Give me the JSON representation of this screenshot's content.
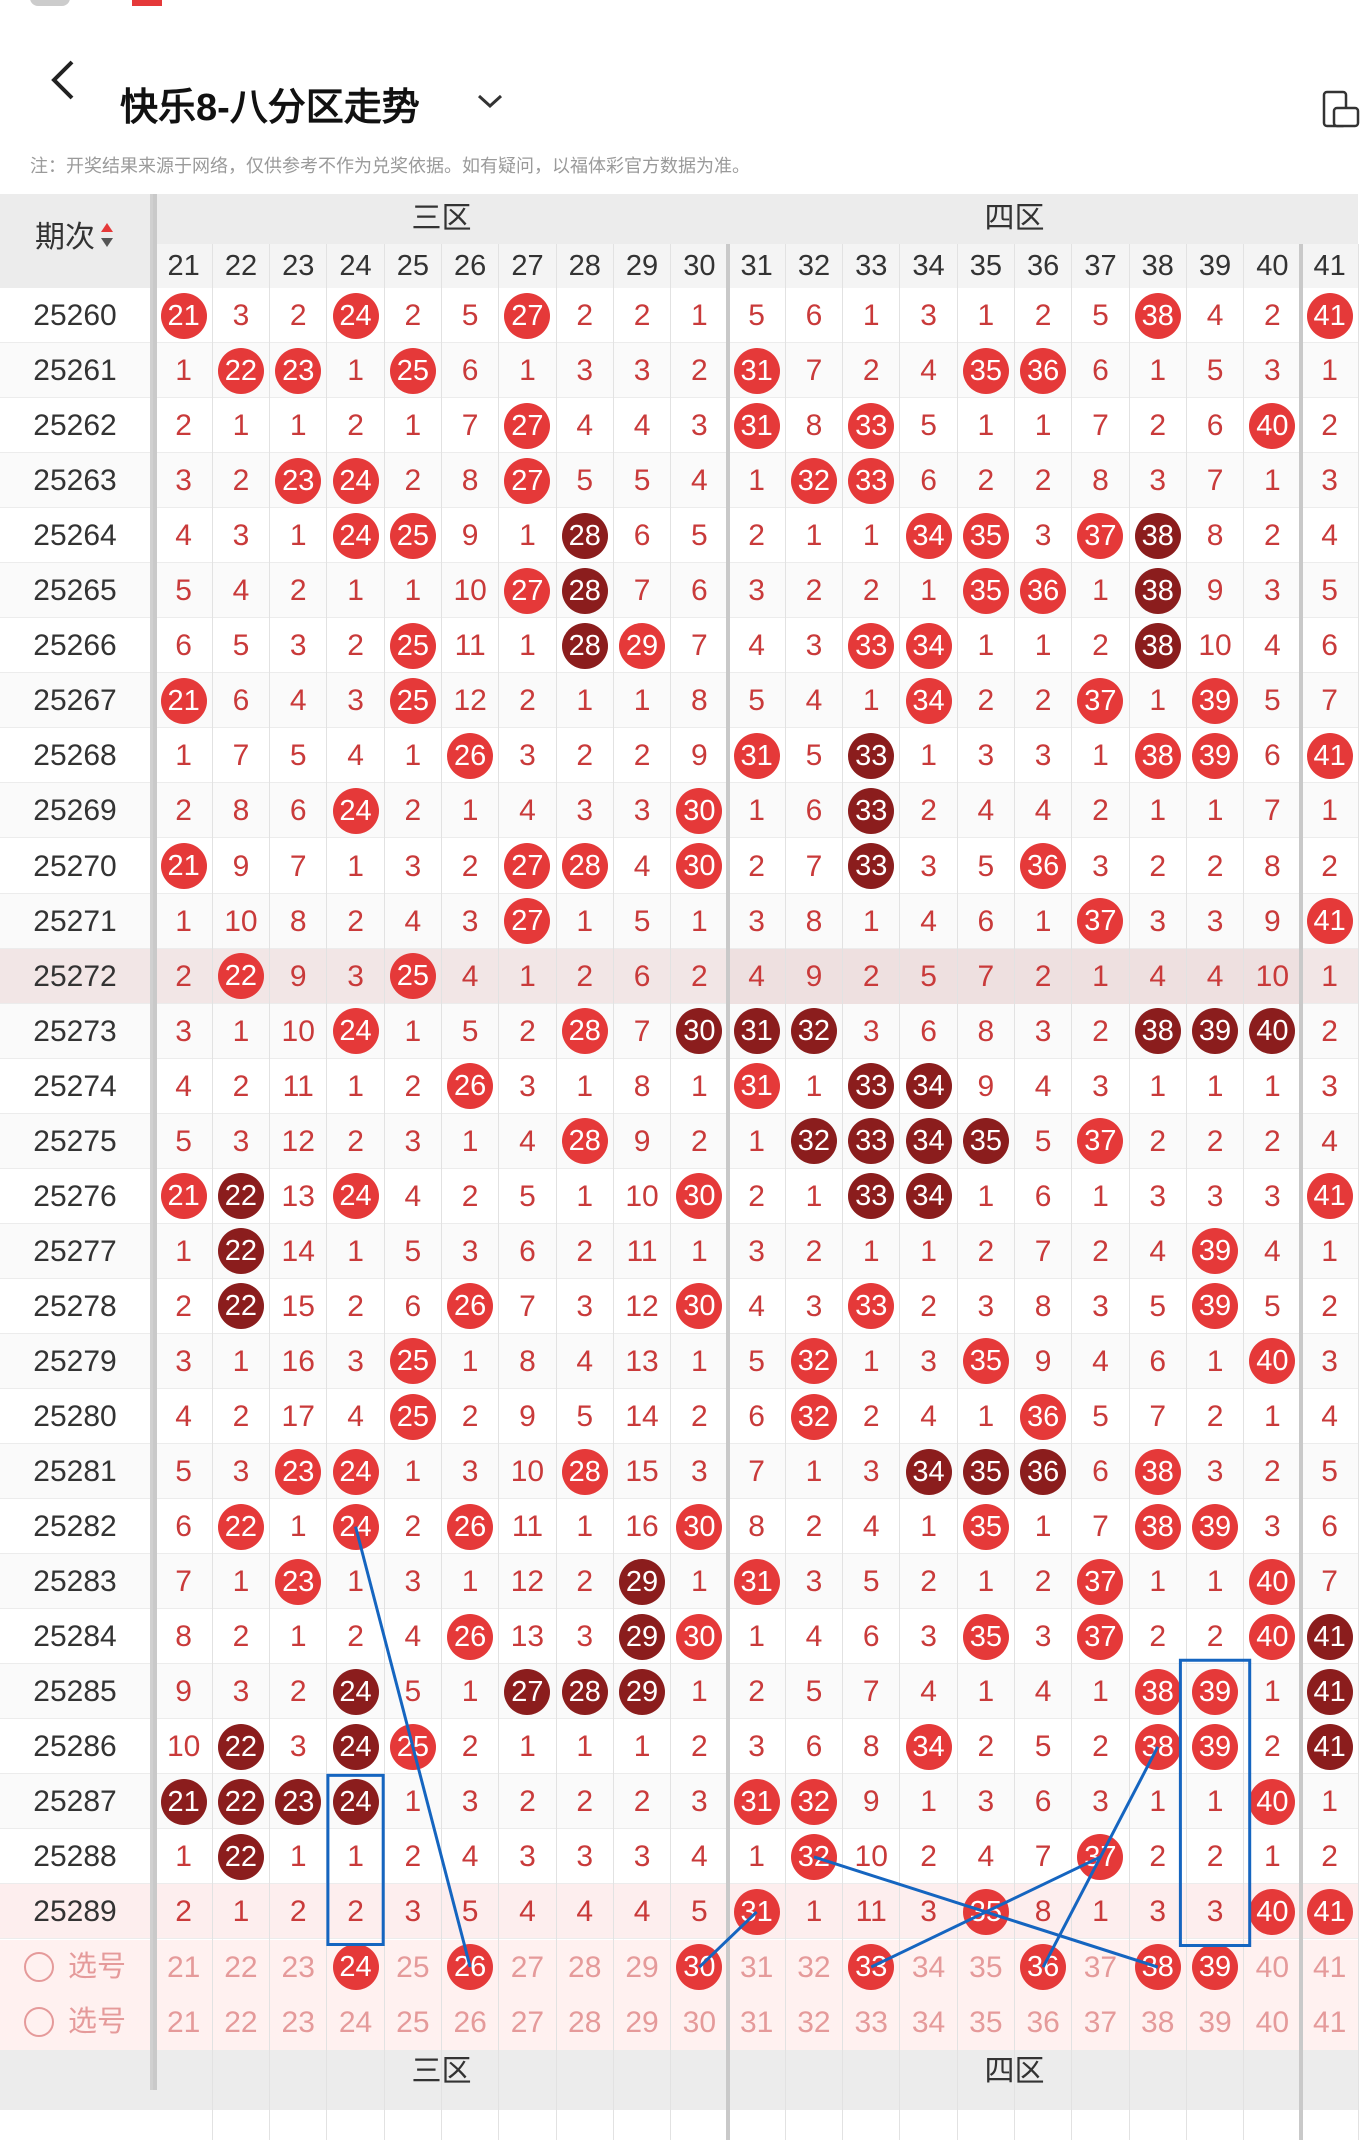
{
  "header": {
    "title": "快乐8-八分区走势",
    "back_icon": "back-arrow-icon",
    "dropdown_icon": "chevron-down-icon",
    "device_icon": "device-switch-icon"
  },
  "note": "注：开奖结果来源于网络，仅供参考不作为兑奖依据。如有疑问，以福体彩官方数据为准。",
  "table": {
    "period_header": "期次",
    "zones": [
      "三区",
      "四区"
    ],
    "columns": [
      "21",
      "22",
      "23",
      "24",
      "25",
      "26",
      "27",
      "28",
      "29",
      "30",
      "31",
      "32",
      "33",
      "34",
      "35",
      "36",
      "37",
      "38",
      "39",
      "40",
      "41"
    ],
    "rows": [
      {
        "p": "25260",
        "v": [
          "21",
          "3",
          "2",
          "24",
          "2",
          "5",
          "27",
          "2",
          "2",
          "1",
          "5",
          "6",
          "1",
          "3",
          "1",
          "2",
          "5",
          "38",
          "4",
          "2",
          "41"
        ]
      },
      {
        "p": "25261",
        "v": [
          "1",
          "22",
          "23",
          "1",
          "25",
          "6",
          "1",
          "3",
          "3",
          "2",
          "31",
          "7",
          "2",
          "4",
          "35",
          "36",
          "6",
          "1",
          "5",
          "3",
          "1"
        ]
      },
      {
        "p": "25262",
        "v": [
          "2",
          "1",
          "1",
          "2",
          "1",
          "7",
          "27",
          "4",
          "4",
          "3",
          "31",
          "8",
          "33",
          "5",
          "1",
          "1",
          "7",
          "2",
          "6",
          "40",
          "2"
        ]
      },
      {
        "p": "25263",
        "v": [
          "3",
          "2",
          "23",
          "24",
          "2",
          "8",
          "27",
          "5",
          "5",
          "4",
          "1",
          "32",
          "33",
          "6",
          "2",
          "2",
          "8",
          "3",
          "7",
          "1",
          "3"
        ]
      },
      {
        "p": "25264",
        "v": [
          "4",
          "3",
          "1",
          "24",
          "25",
          "9",
          "1",
          "28",
          "6",
          "5",
          "2",
          "1",
          "1",
          "34",
          "35",
          "3",
          "37",
          "38",
          "8",
          "2",
          "4"
        ]
      },
      {
        "p": "25265",
        "v": [
          "5",
          "4",
          "2",
          "1",
          "1",
          "10",
          "27",
          "28",
          "7",
          "6",
          "3",
          "2",
          "2",
          "1",
          "35",
          "36",
          "1",
          "38",
          "9",
          "3",
          "5"
        ]
      },
      {
        "p": "25266",
        "v": [
          "6",
          "5",
          "3",
          "2",
          "25",
          "11",
          "1",
          "28",
          "29",
          "7",
          "4",
          "3",
          "33",
          "34",
          "1",
          "1",
          "2",
          "38",
          "10",
          "4",
          "6"
        ]
      },
      {
        "p": "25267",
        "v": [
          "21",
          "6",
          "4",
          "3",
          "25",
          "12",
          "2",
          "1",
          "1",
          "8",
          "5",
          "4",
          "1",
          "34",
          "2",
          "2",
          "37",
          "1",
          "39",
          "5",
          "7"
        ]
      },
      {
        "p": "25268",
        "v": [
          "1",
          "7",
          "5",
          "4",
          "1",
          "26",
          "3",
          "2",
          "2",
          "9",
          "31",
          "5",
          "33",
          "1",
          "3",
          "3",
          "1",
          "38",
          "39",
          "6",
          "41"
        ]
      },
      {
        "p": "25269",
        "v": [
          "2",
          "8",
          "6",
          "24",
          "2",
          "1",
          "4",
          "3",
          "3",
          "30",
          "1",
          "6",
          "33",
          "2",
          "4",
          "4",
          "2",
          "1",
          "1",
          "7",
          "1"
        ]
      },
      {
        "p": "25270",
        "v": [
          "21",
          "9",
          "7",
          "1",
          "3",
          "2",
          "27",
          "28",
          "4",
          "30",
          "2",
          "7",
          "33",
          "3",
          "5",
          "36",
          "3",
          "2",
          "2",
          "8",
          "2"
        ]
      },
      {
        "p": "25271",
        "v": [
          "1",
          "10",
          "8",
          "2",
          "4",
          "3",
          "27",
          "1",
          "5",
          "1",
          "3",
          "8",
          "1",
          "4",
          "6",
          "1",
          "37",
          "3",
          "3",
          "9",
          "41"
        ]
      },
      {
        "p": "25272",
        "v": [
          "2",
          "22",
          "9",
          "3",
          "25",
          "4",
          "1",
          "2",
          "6",
          "2",
          "4",
          "9",
          "2",
          "5",
          "7",
          "2",
          "1",
          "4",
          "4",
          "10",
          "1"
        ]
      },
      {
        "p": "25273",
        "v": [
          "3",
          "1",
          "10",
          "24",
          "1",
          "5",
          "2",
          "28",
          "7",
          "30",
          "31",
          "32",
          "3",
          "6",
          "8",
          "3",
          "2",
          "38",
          "39",
          "40",
          "2"
        ]
      },
      {
        "p": "25274",
        "v": [
          "4",
          "2",
          "11",
          "1",
          "2",
          "26",
          "3",
          "1",
          "8",
          "1",
          "31",
          "1",
          "33",
          "34",
          "9",
          "4",
          "3",
          "1",
          "1",
          "1",
          "3"
        ]
      },
      {
        "p": "25275",
        "v": [
          "5",
          "3",
          "12",
          "2",
          "3",
          "1",
          "4",
          "28",
          "9",
          "2",
          "1",
          "32",
          "33",
          "34",
          "35",
          "5",
          "37",
          "2",
          "2",
          "2",
          "4"
        ]
      },
      {
        "p": "25276",
        "v": [
          "21",
          "22",
          "13",
          "24",
          "4",
          "2",
          "5",
          "1",
          "10",
          "30",
          "2",
          "1",
          "33",
          "34",
          "1",
          "6",
          "1",
          "3",
          "3",
          "3",
          "41"
        ]
      },
      {
        "p": "25277",
        "v": [
          "1",
          "22",
          "14",
          "1",
          "5",
          "3",
          "6",
          "2",
          "11",
          "1",
          "3",
          "2",
          "1",
          "1",
          "2",
          "7",
          "2",
          "4",
          "39",
          "4",
          "1"
        ]
      },
      {
        "p": "25278",
        "v": [
          "2",
          "22",
          "15",
          "2",
          "6",
          "26",
          "7",
          "3",
          "12",
          "30",
          "4",
          "3",
          "33",
          "2",
          "3",
          "8",
          "3",
          "5",
          "39",
          "5",
          "2"
        ]
      },
      {
        "p": "25279",
        "v": [
          "3",
          "1",
          "16",
          "3",
          "25",
          "1",
          "8",
          "4",
          "13",
          "1",
          "5",
          "32",
          "1",
          "3",
          "35",
          "9",
          "4",
          "6",
          "1",
          "40",
          "3"
        ]
      },
      {
        "p": "25280",
        "v": [
          "4",
          "2",
          "17",
          "4",
          "25",
          "2",
          "9",
          "5",
          "14",
          "2",
          "6",
          "32",
          "2",
          "4",
          "1",
          "36",
          "5",
          "7",
          "2",
          "1",
          "4"
        ]
      },
      {
        "p": "25281",
        "v": [
          "5",
          "3",
          "23",
          "24",
          "1",
          "3",
          "10",
          "28",
          "15",
          "3",
          "7",
          "1",
          "3",
          "34",
          "35",
          "36",
          "6",
          "38",
          "3",
          "2",
          "5"
        ]
      },
      {
        "p": "25282",
        "v": [
          "6",
          "22",
          "1",
          "24",
          "2",
          "26",
          "11",
          "1",
          "16",
          "30",
          "8",
          "2",
          "4",
          "1",
          "35",
          "1",
          "7",
          "38",
          "39",
          "3",
          "6"
        ]
      },
      {
        "p": "25283",
        "v": [
          "7",
          "1",
          "23",
          "1",
          "3",
          "1",
          "12",
          "2",
          "29",
          "1",
          "31",
          "3",
          "5",
          "2",
          "1",
          "2",
          "37",
          "1",
          "1",
          "40",
          "7"
        ]
      },
      {
        "p": "25284",
        "v": [
          "8",
          "2",
          "1",
          "2",
          "4",
          "26",
          "13",
          "3",
          "29",
          "30",
          "1",
          "4",
          "6",
          "3",
          "35",
          "3",
          "37",
          "2",
          "2",
          "40",
          "41"
        ]
      },
      {
        "p": "25285",
        "v": [
          "9",
          "3",
          "2",
          "24",
          "5",
          "1",
          "27",
          "28",
          "29",
          "1",
          "2",
          "5",
          "7",
          "4",
          "1",
          "4",
          "1",
          "38",
          "39",
          "1",
          "41"
        ]
      },
      {
        "p": "25286",
        "v": [
          "10",
          "22",
          "3",
          "24",
          "25",
          "2",
          "1",
          "1",
          "1",
          "2",
          "3",
          "6",
          "8",
          "34",
          "2",
          "5",
          "2",
          "38",
          "39",
          "2",
          "41"
        ]
      },
      {
        "p": "25287",
        "v": [
          "21",
          "22",
          "23",
          "24",
          "1",
          "3",
          "2",
          "2",
          "2",
          "3",
          "31",
          "32",
          "9",
          "1",
          "3",
          "6",
          "3",
          "1",
          "1",
          "40",
          "1"
        ]
      },
      {
        "p": "25288",
        "v": [
          "1",
          "22",
          "1",
          "1",
          "2",
          "4",
          "3",
          "3",
          "3",
          "4",
          "1",
          "32",
          "10",
          "2",
          "4",
          "7",
          "37",
          "2",
          "2",
          "1",
          "2"
        ]
      },
      {
        "p": "25289",
        "v": [
          "2",
          "1",
          "2",
          "2",
          "3",
          "5",
          "4",
          "4",
          "4",
          "5",
          "31",
          "1",
          "11",
          "3",
          "35",
          "8",
          "1",
          "3",
          "3",
          "40",
          "41"
        ]
      }
    ],
    "select_label": "选号",
    "select_rows": [
      [
        "21",
        "22",
        "23",
        "24",
        "25",
        "26",
        "27",
        "28",
        "29",
        "30",
        "31",
        "32",
        "33",
        "34",
        "35",
        "36",
        "37",
        "38",
        "39",
        "40",
        "41"
      ],
      [
        "21",
        "22",
        "23",
        "24",
        "25",
        "26",
        "27",
        "28",
        "29",
        "30",
        "31",
        "32",
        "33",
        "34",
        "35",
        "36",
        "37",
        "38",
        "39",
        "40",
        "41"
      ]
    ],
    "selected_picks": [
      "24",
      "26",
      "30",
      "33",
      "36",
      "38",
      "39"
    ]
  },
  "colors": {
    "ball_red": "#e53939",
    "ball_dark": "#8b1d1d",
    "number_text": "#c93a3a",
    "annotation_blue": "#1565c0"
  }
}
